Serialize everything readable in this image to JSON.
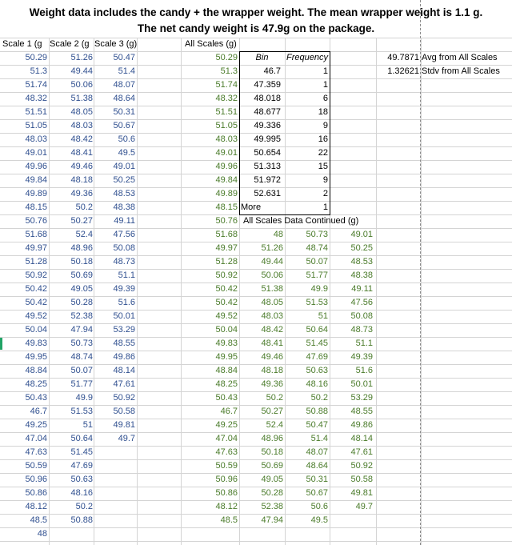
{
  "title_line1": "Weight data includes the candy + the wrapper weight. The mean wrapper weight is 1.1 g.",
  "title_line2": "The net candy weight is 47.9g on the package.",
  "headers": {
    "scale1": "Scale 1 (g",
    "scale2": "Scale 2 (g",
    "scale3": "Scale 3 (g)",
    "all_scales": "All Scales (g)",
    "bin": "Bin",
    "frequency": "Frequency",
    "continued": "All Scales Data Continued (g)"
  },
  "stats": {
    "avg_value": "49.7871",
    "avg_label": "Avg from All Scales",
    "stdv_value": "1.32621",
    "stdv_label": "Stdv from All Scales"
  },
  "scale1": [
    "50.29",
    "51.3",
    "51.74",
    "48.32",
    "51.51",
    "51.05",
    "48.03",
    "49.01",
    "49.96",
    "49.84",
    "49.89",
    "48.15",
    "50.76",
    "51.68",
    "49.97",
    "51.28",
    "50.92",
    "50.42",
    "50.42",
    "49.52",
    "50.04",
    "49.83",
    "49.95",
    "48.84",
    "48.25",
    "50.43",
    "46.7",
    "49.25",
    "47.04",
    "47.63",
    "50.59",
    "50.96",
    "50.86",
    "48.12",
    "48.5",
    "48"
  ],
  "scale2": [
    "51.26",
    "49.44",
    "50.06",
    "51.38",
    "48.05",
    "48.03",
    "48.42",
    "48.41",
    "49.46",
    "48.18",
    "49.36",
    "50.2",
    "50.27",
    "52.4",
    "48.96",
    "50.18",
    "50.69",
    "49.05",
    "50.28",
    "52.38",
    "47.94",
    "50.73",
    "48.74",
    "50.07",
    "51.77",
    "49.9",
    "51.53",
    "51",
    "50.64",
    "51.45",
    "47.69",
    "50.63",
    "48.16",
    "50.2",
    "50.88"
  ],
  "scale3": [
    "50.47",
    "51.4",
    "48.07",
    "48.64",
    "50.31",
    "50.67",
    "50.6",
    "49.5",
    "49.01",
    "50.25",
    "48.53",
    "48.38",
    "49.11",
    "47.56",
    "50.08",
    "48.73",
    "51.1",
    "49.39",
    "51.6",
    "50.01",
    "53.29",
    "48.55",
    "49.86",
    "48.14",
    "47.61",
    "50.92",
    "50.58",
    "49.81",
    "49.7"
  ],
  "all_scales": [
    "50.29",
    "51.3",
    "51.74",
    "48.32",
    "51.51",
    "51.05",
    "48.03",
    "49.01",
    "49.96",
    "49.84",
    "49.89",
    "48.15",
    "50.76",
    "51.68",
    "49.97",
    "51.28",
    "50.92",
    "50.42",
    "50.42",
    "49.52",
    "50.04",
    "49.83",
    "49.95",
    "48.84",
    "48.25",
    "50.43",
    "46.7",
    "49.25",
    "47.04",
    "47.63",
    "50.59",
    "50.96",
    "50.86",
    "48.12",
    "48.5"
  ],
  "bins": [
    {
      "bin": "46.7",
      "freq": "1"
    },
    {
      "bin": "47.359",
      "freq": "1"
    },
    {
      "bin": "48.018",
      "freq": "6"
    },
    {
      "bin": "48.677",
      "freq": "18"
    },
    {
      "bin": "49.336",
      "freq": "9"
    },
    {
      "bin": "49.995",
      "freq": "16"
    },
    {
      "bin": "50.654",
      "freq": "22"
    },
    {
      "bin": "51.313",
      "freq": "15"
    },
    {
      "bin": "51.972",
      "freq": "9"
    },
    {
      "bin": "52.631",
      "freq": "2"
    },
    {
      "bin": "More",
      "freq": "1"
    }
  ],
  "continued_c1": [
    "48",
    "51.26",
    "49.44",
    "50.06",
    "51.38",
    "48.05",
    "48.03",
    "48.42",
    "48.41",
    "49.46",
    "48.18",
    "49.36",
    "50.2",
    "50.27",
    "52.4",
    "48.96",
    "50.18",
    "50.69",
    "49.05",
    "50.28",
    "52.38",
    "47.94"
  ],
  "continued_c2": [
    "50.73",
    "48.74",
    "50.07",
    "51.77",
    "49.9",
    "51.53",
    "51",
    "50.64",
    "51.45",
    "47.69",
    "50.63",
    "48.16",
    "50.2",
    "50.88",
    "50.47",
    "51.4",
    "48.07",
    "48.64",
    "50.31",
    "50.67",
    "50.6",
    "49.5"
  ],
  "continued_c3": [
    "49.01",
    "50.25",
    "48.53",
    "48.38",
    "49.11",
    "47.56",
    "50.08",
    "48.73",
    "51.1",
    "49.39",
    "51.6",
    "50.01",
    "53.29",
    "48.55",
    "49.86",
    "48.14",
    "47.61",
    "50.92",
    "50.58",
    "49.81",
    "49.7"
  ]
}
